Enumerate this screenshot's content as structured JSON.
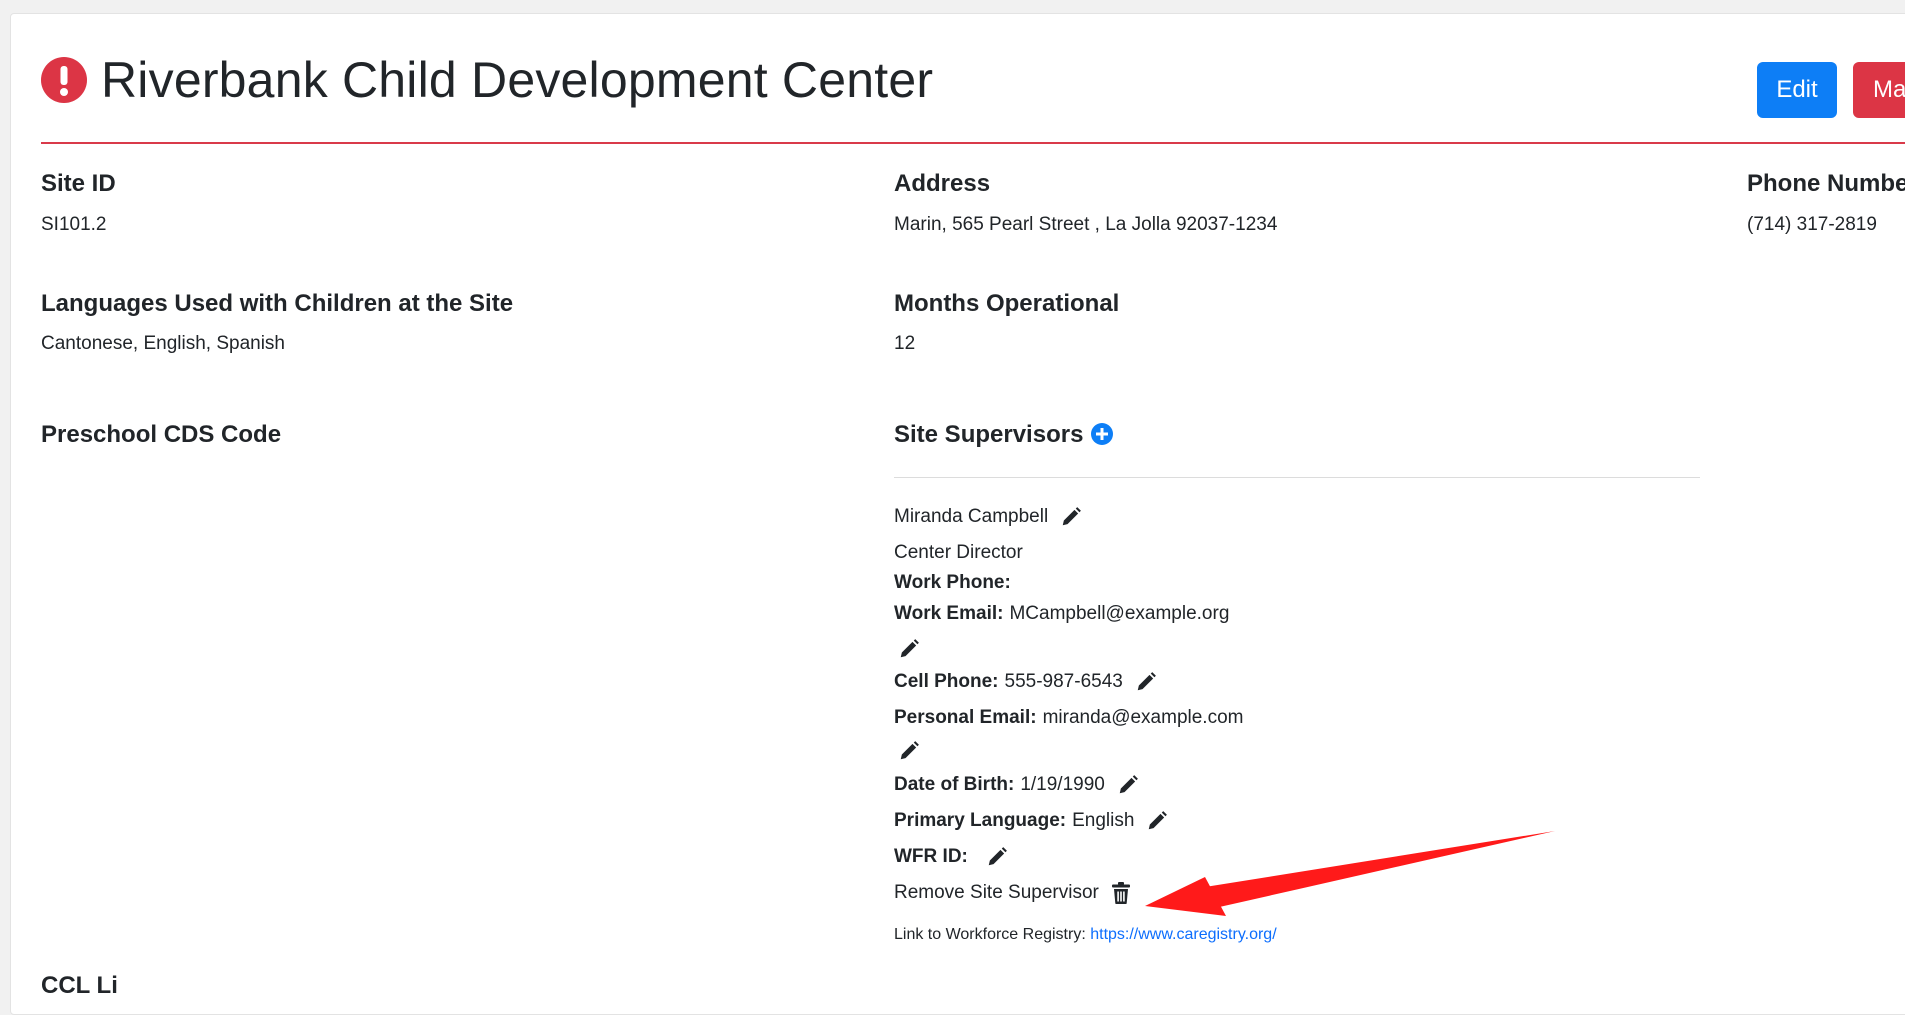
{
  "header": {
    "title": "Riverbank Child Development Center",
    "status_icon": "exclamation-circle-icon",
    "edit_label": "Edit",
    "danger_label_partial": "Ma"
  },
  "fields": {
    "site_id": {
      "label": "Site ID",
      "value": "SI101.2"
    },
    "address": {
      "label": "Address",
      "value": "Marin, 565 Pearl Street , La Jolla 92037-1234"
    },
    "phone": {
      "label": "Phone Numbe",
      "value": "(714) 317-2819"
    },
    "languages": {
      "label": "Languages Used with Children at the Site",
      "value": "Cantonese, English, Spanish"
    },
    "months": {
      "label": "Months Operational",
      "value": "12"
    },
    "cds_code": {
      "label": "Preschool CDS Code",
      "value": ""
    },
    "next_section_label_partial": "CCL Li"
  },
  "supervisors": {
    "label": "Site Supervisors",
    "add_icon": "plus-circle-icon",
    "items": [
      {
        "name": "Miranda Campbell",
        "role": "Center Director",
        "work_phone_label": "Work Phone:",
        "work_phone": "",
        "work_email_label": "Work Email:",
        "work_email": "MCampbell@example.org",
        "cell_phone_label": "Cell Phone:",
        "cell_phone": "555-987-6543",
        "personal_email_label": "Personal Email:",
        "personal_email": "miranda@example.com",
        "dob_label": "Date of Birth:",
        "dob": "1/19/1990",
        "primary_language_label": "Primary Language:",
        "primary_language": "English",
        "wfr_id_label": "WFR ID:",
        "wfr_id": "",
        "remove_label": "Remove Site Supervisor"
      }
    ],
    "registry_label": "Link to Workforce Registry:",
    "registry_link": "https://www.caregistry.org/"
  },
  "colors": {
    "primary": "#0d7ef6",
    "danger": "#dc3545",
    "link": "#0d6efd",
    "annotation_arrow": "#ff1a1a"
  }
}
